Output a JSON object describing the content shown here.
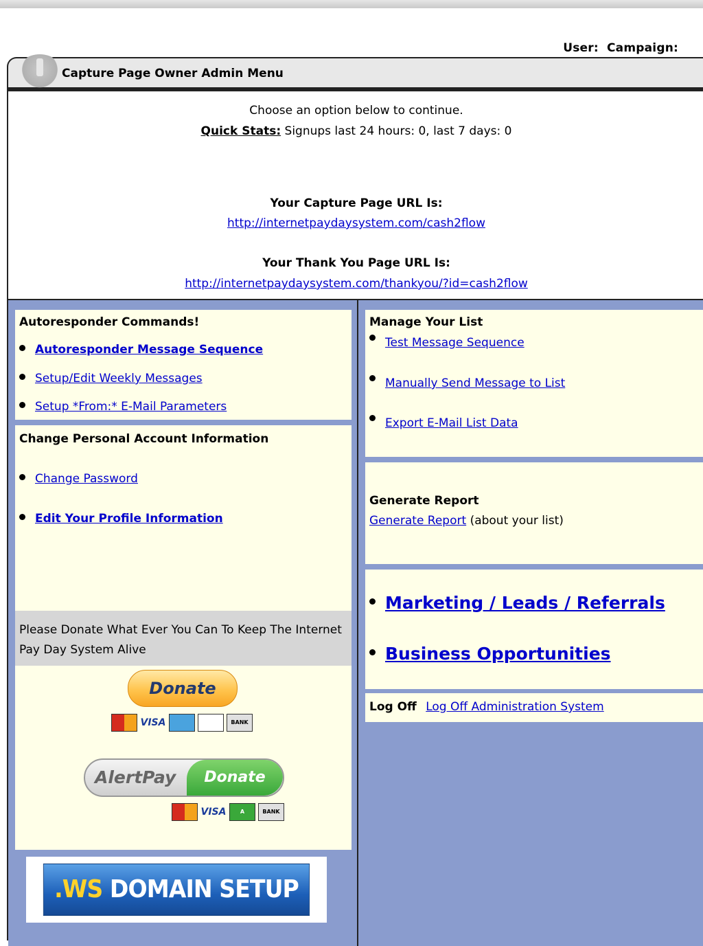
{
  "top": {
    "user_label": "User:",
    "campaign_label": "Campaign:"
  },
  "header": {
    "title": "Capture Page Owner Admin Menu"
  },
  "intro": {
    "choose": "Choose an option below to continue.",
    "quickstats_label": "Quick Stats:",
    "quickstats_text": "Signups last 24 hours: 0, last 7 days: 0",
    "capture_title": "Your Capture Page URL Is:",
    "capture_url": "http://internetpaydaysystem.com/cash2flow",
    "thankyou_title": "Your Thank You Page URL Is:",
    "thankyou_url": "http://internetpaydaysystem.com/thankyou/?id=cash2flow"
  },
  "autoresponder": {
    "title": "Autoresponder Commands!",
    "items": [
      "Autoresponder Message Sequence",
      "Setup/Edit Weekly Messages",
      "Setup *From:* E-Mail Parameters"
    ]
  },
  "account": {
    "title": "Change Personal Account Information",
    "items": [
      "Change Password",
      "Edit Your Profile Information"
    ]
  },
  "donate": {
    "text": "Please Donate What Ever You Can To Keep The Internet Pay Day System Alive",
    "button": "Donate",
    "cards": [
      "MasterCard",
      "VISA",
      "AMERICAN EXPRESS",
      "DISCOVER",
      "BANK"
    ],
    "alertpay_left": "AlertPay",
    "alertpay_right": "Donate",
    "alertpay_cards": [
      "MasterCard",
      "VISA",
      "A",
      "BANK"
    ]
  },
  "ws_banner": {
    "ws": ".WS",
    "rest": " DOMAIN SETUP"
  },
  "manage": {
    "title": "Manage Your List",
    "items": [
      "Test Message Sequence",
      "Manually Send Message to List",
      "Export E-Mail List Data"
    ]
  },
  "report": {
    "title": "Generate Report",
    "link": "Generate Report",
    "suffix": "(about your list)"
  },
  "big_links": {
    "marketing": "Marketing / Leads / Referrals",
    "business": "Business Opportunities"
  },
  "logoff": {
    "label": "Log Off",
    "link": "Log Off Administration System"
  }
}
